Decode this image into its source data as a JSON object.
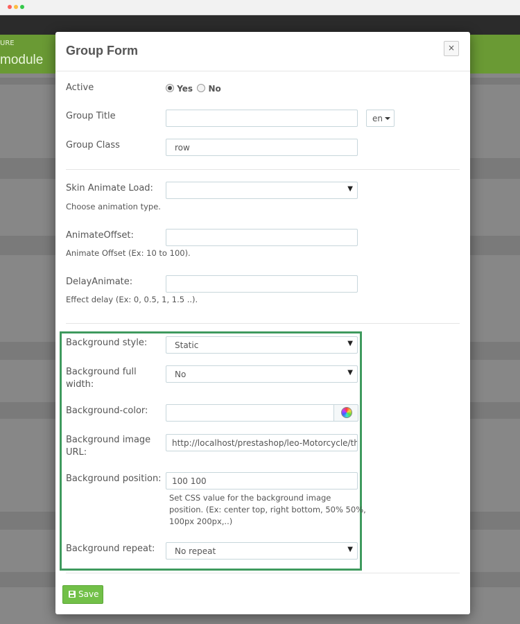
{
  "background_page": {
    "header_small": "URE",
    "header_title": "module"
  },
  "modal": {
    "title": "Group Form",
    "close_label": "×",
    "active": {
      "label": "Active",
      "options": [
        "Yes",
        "No"
      ],
      "selected": "Yes"
    },
    "group_title": {
      "label": "Group Title",
      "value": "",
      "language": "en"
    },
    "group_class": {
      "label": "Group Class",
      "value": "row"
    },
    "skin_animate_load": {
      "label": "Skin Animate Load:",
      "value": "",
      "help": "Choose animation type."
    },
    "animate_offset": {
      "label": "AnimateOffset:",
      "value": "",
      "help": "Animate Offset (Ex: 10 to 100)."
    },
    "delay_animate": {
      "label": "DelayAnimate:",
      "value": "",
      "help": "Effect delay (Ex: 0, 0.5, 1, 1.5 ..)."
    },
    "background_style": {
      "label": "Background style:",
      "value": "Static"
    },
    "background_full_width": {
      "label_line1": "Background full",
      "label_line2": "width:",
      "value": "No"
    },
    "background_color": {
      "label": "Background-color:",
      "value": ""
    },
    "background_image_url": {
      "label_line1": "Background image",
      "label_line2": "URL:",
      "value": "http://localhost/prestashop/leo-Motorcycle/the"
    },
    "background_position": {
      "label": "Background position:",
      "value": "100 100",
      "help_line1": "Set CSS value for the background image",
      "help_line2": "position. (Ex: center top, right bottom, 50% 50%,",
      "help_line3": "100px 200px,..)"
    },
    "background_repeat": {
      "label": "Background repeat:",
      "value": "No repeat"
    },
    "save_label": "Save"
  },
  "colors": {
    "save_button": "#72c048",
    "highlight_box": "#3f9a5e",
    "header_green": "#6a9a34"
  }
}
